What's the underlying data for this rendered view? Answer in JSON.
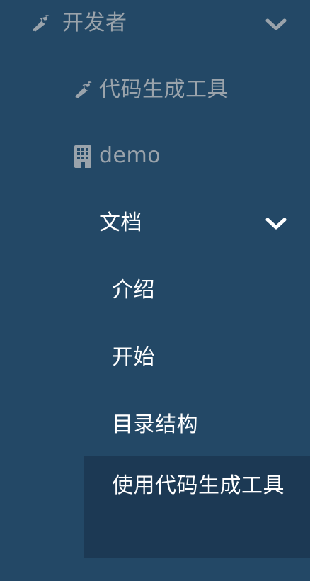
{
  "menu": {
    "developer": {
      "label": "开发者",
      "icon": "wrench-icon",
      "expanded": true
    },
    "codegen": {
      "label": "代码生成工具",
      "icon": "wrench-icon"
    },
    "demo": {
      "label": "demo",
      "icon": "building-icon"
    },
    "docs": {
      "label": "文档",
      "expanded": true,
      "items": [
        {
          "label": "介绍"
        },
        {
          "label": "开始"
        },
        {
          "label": "目录结构"
        },
        {
          "label": "使用代码生成工具",
          "active": true
        }
      ]
    }
  },
  "colors": {
    "background": "#234866",
    "active_background": "#1c3954",
    "muted_text": "#9aa3ab",
    "text": "#ffffff"
  }
}
